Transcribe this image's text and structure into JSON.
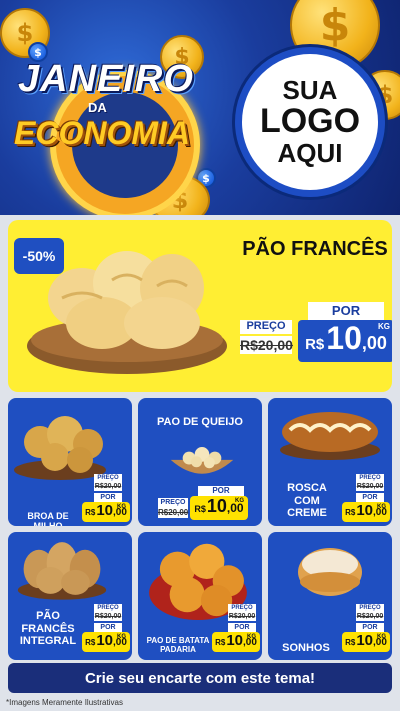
{
  "header": {
    "title_line1": "JANEIRO",
    "title_line2": "DA",
    "title_line3": "ECONOMIA",
    "logo_placeholder": {
      "line1": "SUA",
      "line2": "LOGO",
      "line3": "AQUI"
    }
  },
  "main_product": {
    "discount": "-50%",
    "name": "PÃO FRANCÊS",
    "preco_label": "PREÇO",
    "old_price": "R$20,00",
    "por_label": "POR",
    "currency": "R$",
    "price_int": "10",
    "price_dec": ",00",
    "unit": "KG"
  },
  "products": [
    {
      "name": "BROA DE MILHO",
      "preco_label": "PREÇO",
      "old_price": "R$20,00",
      "por_label": "POR",
      "currency": "R$",
      "price_int": "10",
      "price_dec": ",00",
      "unit": "KG"
    },
    {
      "name": "PAO DE QUEIJO",
      "preco_label": "PREÇO",
      "old_price": "R$20,00",
      "por_label": "POR",
      "currency": "R$",
      "price_int": "10",
      "price_dec": ",00",
      "unit": "KG"
    },
    {
      "name": "ROSCA COM CREME",
      "preco_label": "PREÇO",
      "old_price": "R$20,00",
      "por_label": "POR",
      "currency": "R$",
      "price_int": "10",
      "price_dec": ",00",
      "unit": "KG"
    },
    {
      "name": "PÃO FRANCÊS INTEGRAL",
      "preco_label": "PREÇO",
      "old_price": "R$20,00",
      "por_label": "POR",
      "currency": "R$",
      "price_int": "10",
      "price_dec": ",00",
      "unit": "KG"
    },
    {
      "name": "PAO DE BATATA PADARIA",
      "preco_label": "PREÇO",
      "old_price": "R$20,00",
      "por_label": "POR",
      "currency": "R$",
      "price_int": "10",
      "price_dec": ",00",
      "unit": "KG"
    },
    {
      "name": "SONHOS",
      "preco_label": "PREÇO",
      "old_price": "R$20,00",
      "por_label": "POR",
      "currency": "R$",
      "price_int": "10",
      "price_dec": ",00",
      "unit": "KG"
    }
  ],
  "cta": {
    "label": "Crie seu encarte com este tema!"
  },
  "footnote": "*Imagens Meramente Ilustrativas",
  "colors": {
    "brand_blue": "#1f4fc1",
    "yellow": "#ffee33",
    "dark_navy": "#1a2e7a",
    "gold": "#f2b31b"
  },
  "icons": [
    "dollar-coin-icon"
  ]
}
